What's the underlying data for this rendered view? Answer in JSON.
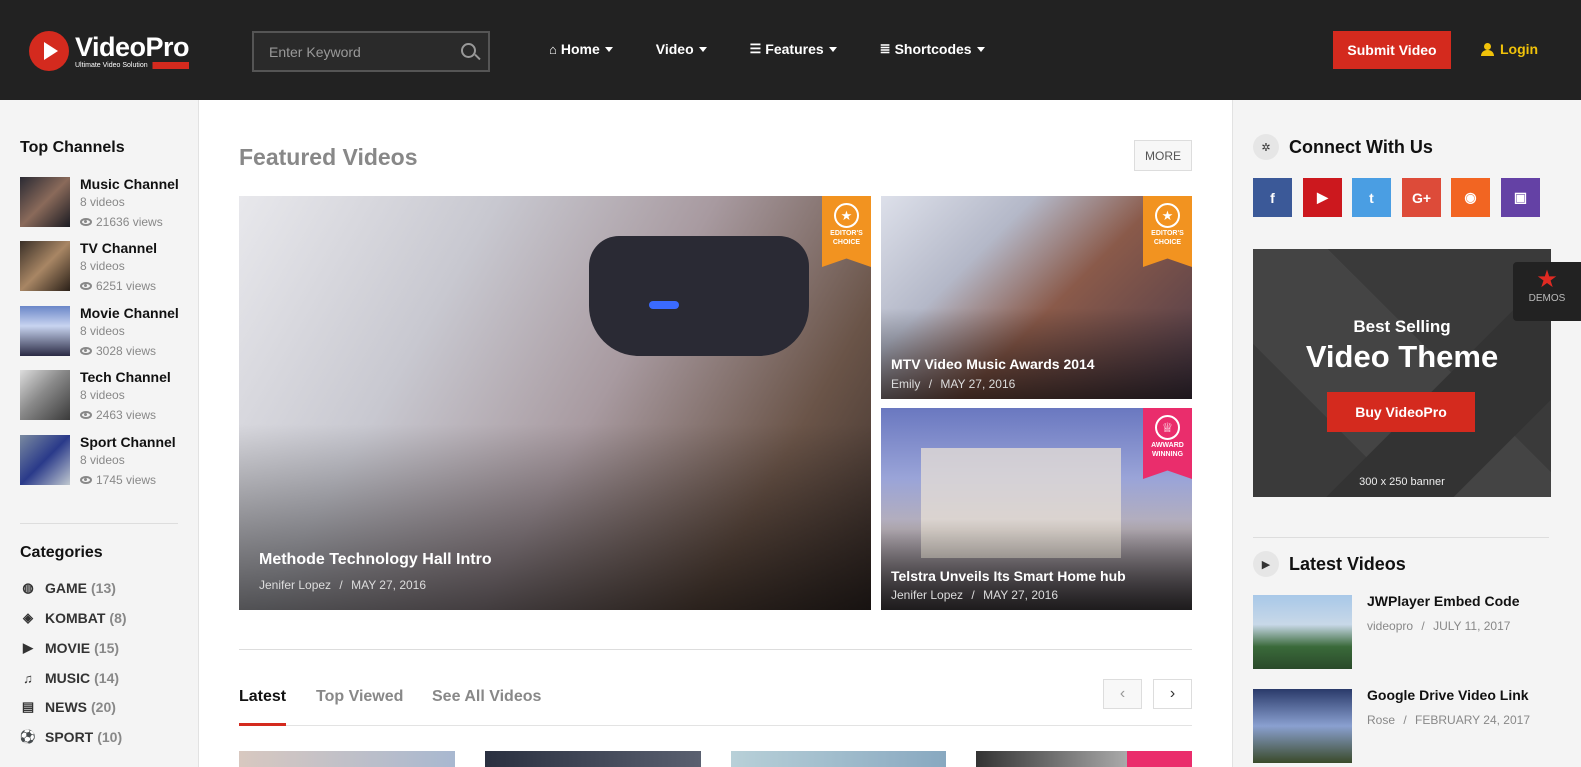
{
  "header": {
    "logo_name": "VideoPro",
    "logo_tagline": "Ultimate Video Solution",
    "search_placeholder": "Enter Keyword",
    "nav": [
      {
        "label": "Home",
        "icon": "home-icon"
      },
      {
        "label": "Video",
        "icon": ""
      },
      {
        "label": "Features",
        "icon": "list-icon"
      },
      {
        "label": "Shortcodes",
        "icon": "database-icon"
      }
    ],
    "submit_label": "Submit Video",
    "login_label": "Login"
  },
  "left_sidebar": {
    "channels_title": "Top Channels",
    "channels": [
      {
        "name": "Music Channel",
        "count": "8 videos",
        "views": "21636 views"
      },
      {
        "name": "TV Channel",
        "count": "8 videos",
        "views": "6251 views"
      },
      {
        "name": "Movie Channel",
        "count": "8 videos",
        "views": "3028 views"
      },
      {
        "name": "Tech Channel",
        "count": "8 videos",
        "views": "2463 views"
      },
      {
        "name": "Sport Channel",
        "count": "8 videos",
        "views": "1745 views"
      }
    ],
    "categories_title": "Categories",
    "categories": [
      {
        "name": "GAME",
        "count": "(13)",
        "icon": "gamepad-icon"
      },
      {
        "name": "KOMBAT",
        "count": "(8)",
        "icon": "shield-icon"
      },
      {
        "name": "MOVIE",
        "count": "(15)",
        "icon": "play-circle-icon"
      },
      {
        "name": "MUSIC",
        "count": "(14)",
        "icon": "music-icon"
      },
      {
        "name": "NEWS",
        "count": "(20)",
        "icon": "newspaper-icon"
      },
      {
        "name": "SPORT",
        "count": "(10)",
        "icon": "soccer-ball-icon"
      }
    ]
  },
  "main": {
    "featured_title": "Featured Videos",
    "more_label": "MORE",
    "featured": [
      {
        "title": "Methode Technology Hall Intro",
        "author": "Jenifer Lopez",
        "date": "MAY 27, 2016",
        "badge": "",
        "badge_line1": "",
        "badge_line2": ""
      },
      {
        "title": "MTV Video Music Awards 2014",
        "author": "Emily",
        "date": "MAY 27, 2016",
        "badge": "editor",
        "badge_line1": "EDITOR'S",
        "badge_line2": "CHOICE"
      },
      {
        "title": "Telstra Unveils Its Smart Home hub",
        "author": "Jenifer Lopez",
        "date": "MAY 27, 2016",
        "badge": "award",
        "badge_line1": "AWWARD",
        "badge_line2": "WINNING"
      }
    ],
    "main_badge": {
      "line1": "EDITOR'S",
      "line2": "CHOICE"
    },
    "separator": "/",
    "tabs": [
      {
        "label": "Latest",
        "active": true
      },
      {
        "label": "Top Viewed",
        "active": false
      },
      {
        "label": "See All Videos",
        "active": false
      }
    ],
    "prev_icon": "chevron-left-icon",
    "next_icon": "chevron-right-icon"
  },
  "right_sidebar": {
    "connect_title": "Connect With Us",
    "socials": [
      {
        "name": "facebook-icon",
        "glyph": "f",
        "color": "#3b5998"
      },
      {
        "name": "youtube-icon",
        "glyph": "▶",
        "color": "#cc181e"
      },
      {
        "name": "twitter-icon",
        "glyph": "t",
        "color": "#4a9ee3"
      },
      {
        "name": "google-plus-icon",
        "glyph": "G+",
        "color": "#dd4b39"
      },
      {
        "name": "rss-icon",
        "glyph": "◉",
        "color": "#f26522"
      },
      {
        "name": "twitch-icon",
        "glyph": "▣",
        "color": "#6441a5"
      }
    ],
    "banner": {
      "line1": "Best Selling",
      "line2": "Video Theme",
      "button": "Buy VideoPro",
      "size": "300 x 250 banner"
    },
    "latest_title": "Latest Videos",
    "latest": [
      {
        "title": "JWPlayer Embed Code",
        "author": "videopro",
        "date": "JULY 11, 2017"
      },
      {
        "title": "Google Drive Video Link",
        "author": "Rose",
        "date": "FEBRUARY 24, 2017"
      }
    ]
  },
  "demos_label": "DEMOS",
  "colors": {
    "header_bg": "#222222",
    "accent_red": "#d42a1e",
    "login_yellow": "#f0c20a",
    "badge_orange": "#f29320",
    "badge_pink": "#ea2d6c"
  }
}
